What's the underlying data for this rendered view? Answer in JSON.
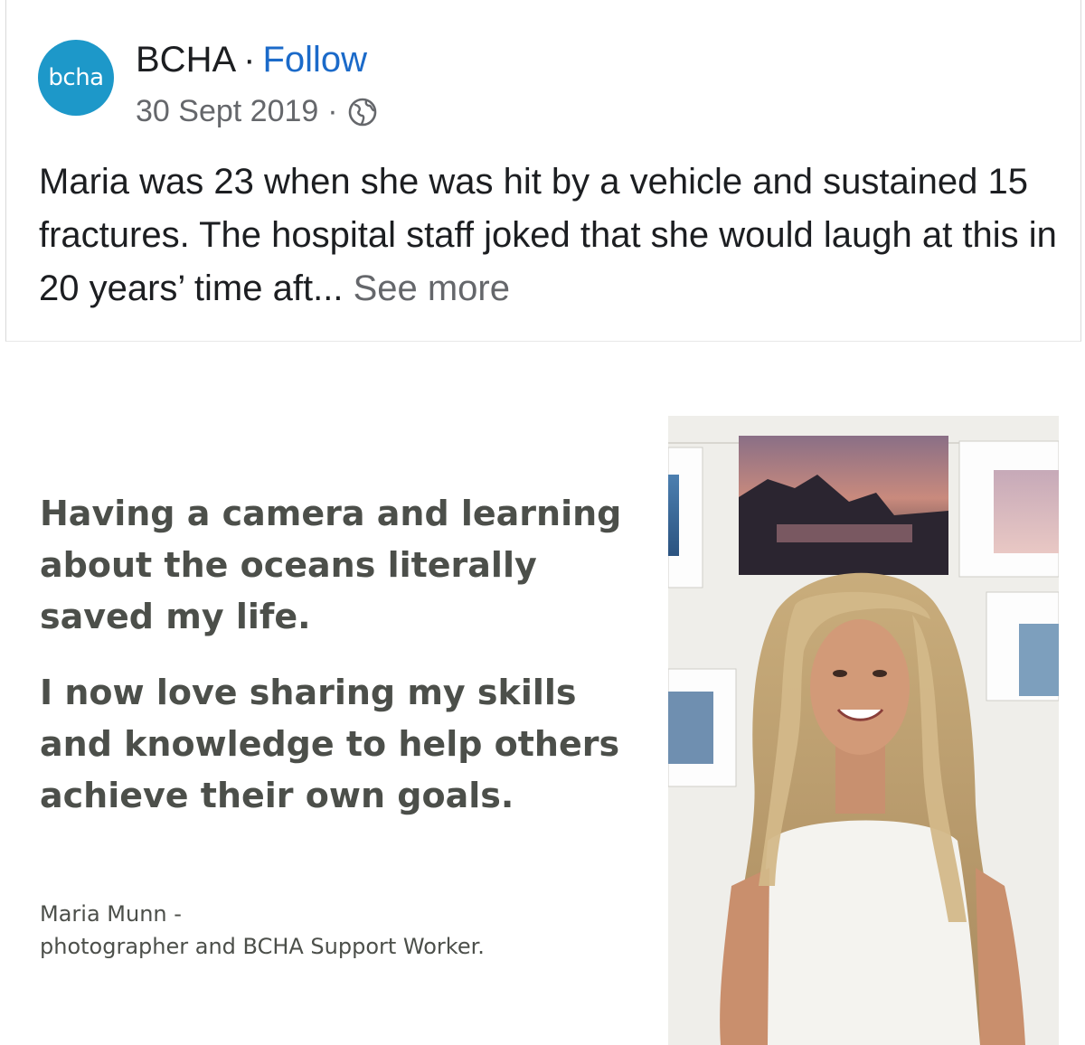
{
  "post": {
    "avatar_text": "bcha",
    "page_name": "BCHA",
    "separator": "·",
    "follow_label": "Follow",
    "date": "30 Sept 2019",
    "audience_icon": "globe-icon",
    "text": "Maria was 23 when she was hit by a vehicle and sustained 15 fractures.  The hospital staff joked that she would laugh at this in 20 years’ time aft...",
    "see_more_label": "See more"
  },
  "image": {
    "quote": [
      "Having a camera and learning about the oceans literally saved my life.",
      "I now love sharing my skills and knowledge to help others achieve their own goals."
    ],
    "attribution_name": "Maria Munn -",
    "attribution_role": "photographer and BCHA Support Worker."
  },
  "colors": {
    "brand": "#1d98c9",
    "link": "#1b6ac9",
    "quote_text": "#4c4f4a"
  }
}
